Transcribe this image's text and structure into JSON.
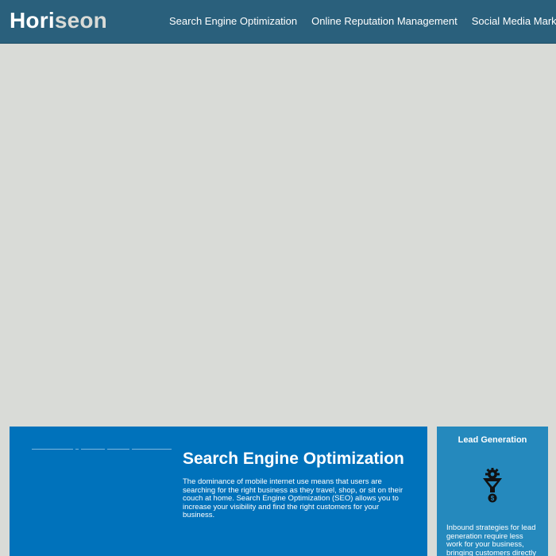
{
  "header": {
    "logo_part1": "Hori",
    "logo_part2": "seon",
    "nav": [
      {
        "label": "Search Engine Optimization"
      },
      {
        "label": "Online Reputation Management"
      },
      {
        "label": "Social Media Marketing"
      }
    ]
  },
  "main_card": {
    "title": "Search Engine Optimization",
    "text": "The dominance of mobile internet use means that users are searching for the right business as they travel, shop, or sit on their couch at home. Search Engine Optimization (SEO) allows you to increase your visibility and find the right customers for your business."
  },
  "side_card": {
    "title": "Lead Generation",
    "icon": "funnel-gear-icon",
    "text": "Inbound strategies for lead generation require less work for your business, bringing customers directly"
  },
  "colors": {
    "header_bg": "#2a607c",
    "page_bg": "#d9dbd7",
    "main_card_bg": "#0072bb",
    "side_card_bg": "#2589bd"
  }
}
